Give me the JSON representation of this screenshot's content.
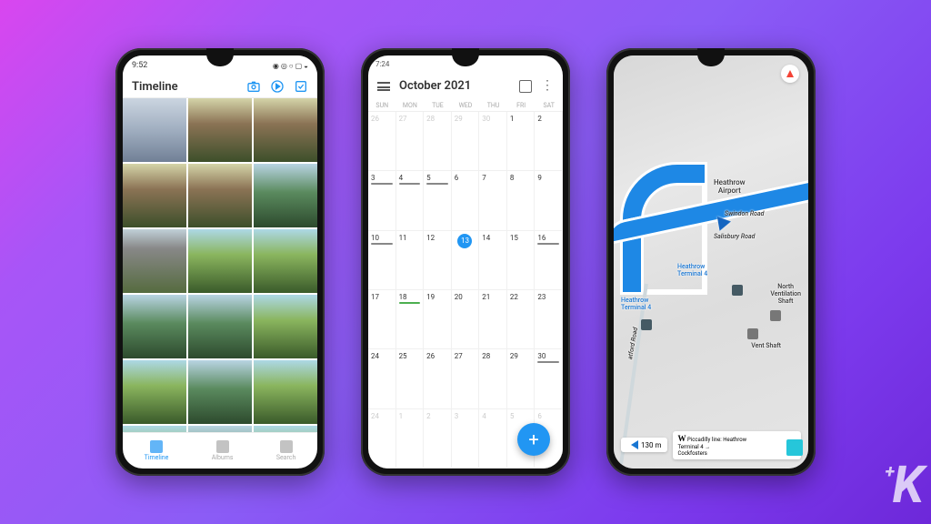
{
  "phone1": {
    "status_time": "9:52",
    "title": "Timeline",
    "nav": {
      "timeline": "Timeline",
      "albums": "Albums",
      "search": "Search"
    }
  },
  "phone2": {
    "status_time": "7:24",
    "month_title": "October 2021",
    "weekdays": [
      "SUN",
      "MON",
      "TUE",
      "WED",
      "THU",
      "FRI",
      "SAT"
    ],
    "days": [
      {
        "n": "26",
        "dim": true
      },
      {
        "n": "27",
        "dim": true
      },
      {
        "n": "28",
        "dim": true
      },
      {
        "n": "29",
        "dim": true
      },
      {
        "n": "30",
        "dim": true
      },
      {
        "n": "1"
      },
      {
        "n": "2"
      },
      {
        "n": "3",
        "ev": [
          {
            "t": "gray",
            "l": ""
          }
        ]
      },
      {
        "n": "4",
        "ev": [
          {
            "t": "gray",
            "l": ""
          }
        ]
      },
      {
        "n": "5",
        "ev": [
          {
            "t": "gray",
            "l": ""
          }
        ]
      },
      {
        "n": "6"
      },
      {
        "n": "7"
      },
      {
        "n": "8"
      },
      {
        "n": "9"
      },
      {
        "n": "10",
        "ev": [
          {
            "t": "gray",
            "l": ""
          }
        ]
      },
      {
        "n": "11"
      },
      {
        "n": "12"
      },
      {
        "n": "13",
        "today": true
      },
      {
        "n": "14"
      },
      {
        "n": "15"
      },
      {
        "n": "16",
        "ev": [
          {
            "t": "gray",
            "l": ""
          }
        ]
      },
      {
        "n": "17"
      },
      {
        "n": "18",
        "ev": [
          {
            "t": "green",
            "l": ""
          }
        ]
      },
      {
        "n": "19"
      },
      {
        "n": "20"
      },
      {
        "n": "21"
      },
      {
        "n": "22"
      },
      {
        "n": "23"
      },
      {
        "n": "24"
      },
      {
        "n": "25"
      },
      {
        "n": "26"
      },
      {
        "n": "27"
      },
      {
        "n": "28"
      },
      {
        "n": "29"
      },
      {
        "n": "30",
        "ev": [
          {
            "t": "gray",
            "l": ""
          }
        ]
      },
      {
        "n": "24",
        "dim": true
      },
      {
        "n": "1",
        "dim": true
      },
      {
        "n": "2",
        "dim": true
      },
      {
        "n": "3",
        "dim": true
      },
      {
        "n": "4",
        "dim": true
      },
      {
        "n": "5",
        "dim": true
      },
      {
        "n": "6",
        "dim": true
      }
    ],
    "fab": "+"
  },
  "phone3": {
    "labels": {
      "heathrow": "Heathrow\nAirport",
      "swindon": "Swindon Road",
      "salisbury": "Salisbury Road",
      "t4a": "Heathrow\nTerminal 4",
      "t4b": "Heathrow\nTerminal 4",
      "north_vent": "North\nVentilation\nShaft",
      "vent": "Vent Shaft",
      "atford": "atford Road"
    },
    "wiki": {
      "symbol": "W",
      "text": "Piccadilly line: Heathrow\nTerminal 4 →\nCockfosters"
    },
    "distance": "130 m"
  },
  "watermark": "K"
}
